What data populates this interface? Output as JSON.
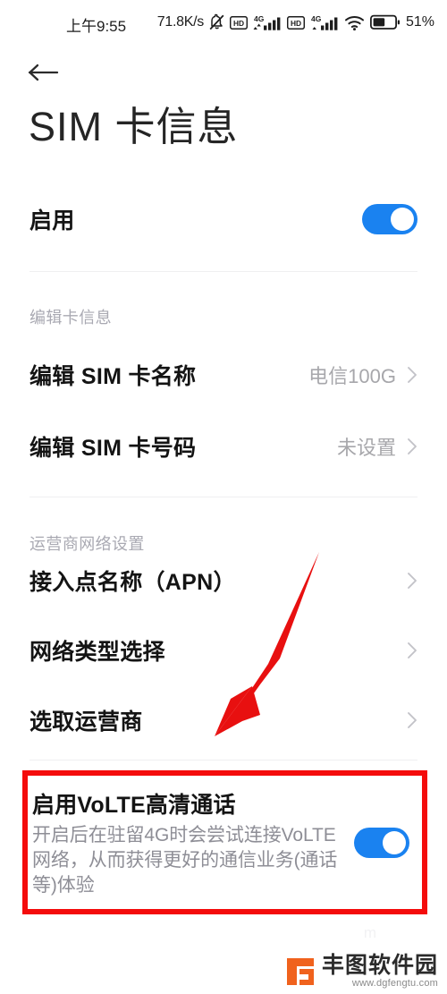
{
  "statusbar": {
    "time": "上午9:55",
    "network_speed": "71.8K/s",
    "battery_percent": "51%",
    "icons": [
      "mute-icon",
      "hd-icon",
      "4g-signal-icon",
      "hd-icon",
      "4g-signal-icon",
      "wifi-icon",
      "battery-icon"
    ]
  },
  "header": {
    "back_label": "←",
    "title": "SIM 卡信息"
  },
  "enable_row": {
    "label": "启用",
    "toggle_on": true
  },
  "sections": [
    {
      "heading": "编辑卡信息",
      "rows": [
        {
          "label": "编辑 SIM 卡名称",
          "value": "电信100G"
        },
        {
          "label": "编辑 SIM 卡号码",
          "value": "未设置"
        }
      ]
    },
    {
      "heading": "运营商网络设置",
      "rows": [
        {
          "label": "接入点名称（APN）",
          "value": ""
        },
        {
          "label": "网络类型选择",
          "value": ""
        },
        {
          "label": "选取运营商",
          "value": ""
        }
      ]
    }
  ],
  "volte": {
    "title": "启用VoLTE高清通话",
    "subtitle": "开启后在驻留4G时会尝试连接VoLTE网络，从而获得更好的通信业务(通话等)体验",
    "toggle_on": true,
    "highlight_color": "#f40c0c"
  },
  "annotation": {
    "arrow_color": "#e81010"
  },
  "watermark": {
    "name": "丰图软件园",
    "url": "www.dgfengtu.com",
    "logo_color": "#f0621d",
    "ghost_text": "m"
  },
  "colors": {
    "accent_blue": "#1a82f0",
    "value_gray": "#a7a7ab",
    "section_gray": "#a9a9b2",
    "divider": "#efeff1"
  }
}
